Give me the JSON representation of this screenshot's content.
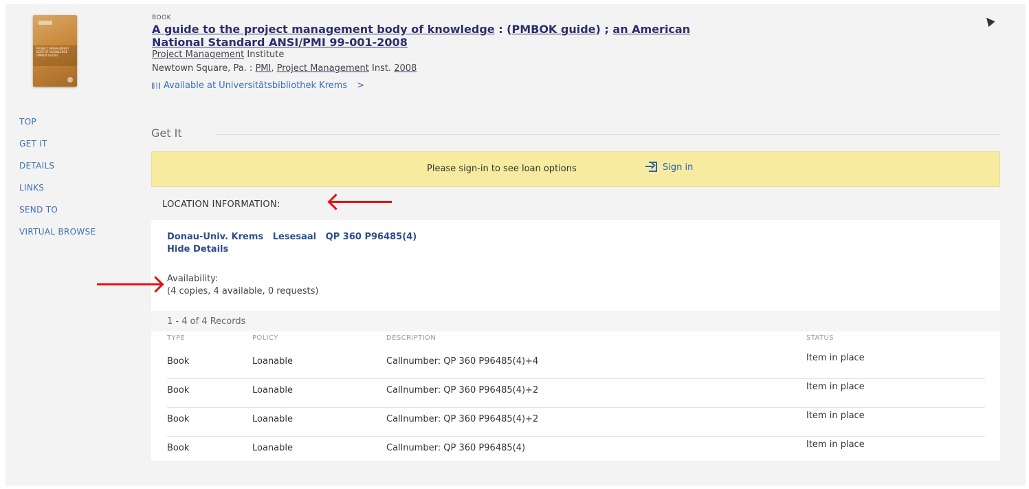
{
  "record": {
    "type": "BOOK",
    "title_links": [
      {
        "text": "A guide to the project management body of knowledge"
      },
      {
        "text": "PMBOK guide"
      },
      {
        "text": "an American National Standard ANSI/PMI 99-001-2008"
      }
    ],
    "title_sep1": " : (",
    "title_sep2": ") ; ",
    "author_link": "Project Management",
    "author_rest": " Institute",
    "pub_prefix": "Newtown Square, Pa. : ",
    "pub_link1": "PMI",
    "pub_sep": ", ",
    "pub_link2": "Project Management",
    "pub_mid": " Inst. ",
    "pub_year": "2008",
    "availability": "Available at Universitätsbibliothek Krems",
    "availability_chevron": ">",
    "cover_text": "PROJECT MANAGEMENT BODY OF KNOWLEDGE (PMBOK GUIDE)"
  },
  "nav": {
    "items": [
      "TOP",
      "GET IT",
      "DETAILS",
      "LINKS",
      "SEND TO",
      "VIRTUAL BROWSE"
    ]
  },
  "get_it": {
    "section_title": "Get It",
    "signin_message": "Please sign-in to see loan options",
    "signin_button": "Sign in",
    "location_info_label": "LOCATION INFORMATION:",
    "location": "Donau-Univ. Krems   Lesesaal   QP 360 P96485(4)",
    "hide_details": "Hide Details",
    "availability_label": "Availability:",
    "availability_counts": "(4 copies, 4 available, 0 requests)",
    "records_count": "1 - 4 of 4 Records",
    "columns": [
      "TYPE",
      "POLICY",
      "DESCRIPTION",
      "STATUS"
    ],
    "rows": [
      {
        "type": "Book",
        "policy": "Loanable",
        "description": "Callnumber: QP 360 P96485(4)+4",
        "status": "Item in place"
      },
      {
        "type": "Book",
        "policy": "Loanable",
        "description": "Callnumber: QP 360 P96485(4)+2",
        "status": "Item in place"
      },
      {
        "type": "Book",
        "policy": "Loanable",
        "description": "Callnumber: QP 360 P96485(4)+2",
        "status": "Item in place"
      },
      {
        "type": "Book",
        "policy": "Loanable",
        "description": "Callnumber: QP 360 P96485(4)",
        "status": "Item in place"
      }
    ]
  },
  "colors": {
    "link_dark": "#2d2d6b",
    "link_blue": "#3b6fb6",
    "signin_bar": "#f6eb9f",
    "annotation_arrow": "#e81010"
  },
  "icons": {
    "pin": "pin-icon",
    "availability": "book-icon",
    "signin": "sign-in-icon"
  }
}
